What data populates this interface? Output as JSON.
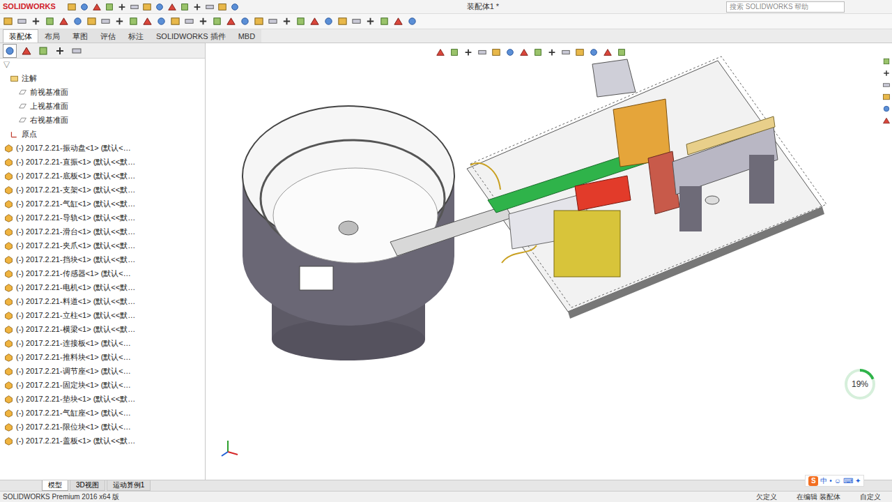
{
  "app": {
    "logo": "SOLIDWORKS",
    "title": "装配体1 *",
    "search_placeholder": "搜索 SOLIDWORKS 帮助"
  },
  "command_tabs": [
    {
      "label": "装配体",
      "selected": true
    },
    {
      "label": "布局",
      "selected": false
    },
    {
      "label": "草图",
      "selected": false
    },
    {
      "label": "评估",
      "selected": false
    },
    {
      "label": "标注",
      "selected": false
    },
    {
      "label": "SOLIDWORKS 插件",
      "selected": false
    },
    {
      "label": "MBD",
      "selected": false
    }
  ],
  "panel_tabs": [
    {
      "selected": true
    },
    {
      "selected": false
    },
    {
      "selected": false
    },
    {
      "selected": false
    },
    {
      "selected": false
    }
  ],
  "tree": {
    "filter": "▽",
    "items": [
      {
        "label": "注解",
        "kind": "folder"
      },
      {
        "label": "前视基准面",
        "kind": "plane"
      },
      {
        "label": "上视基准面",
        "kind": "plane"
      },
      {
        "label": "右视基准面",
        "kind": "plane"
      },
      {
        "label": "原点",
        "kind": "origin"
      },
      {
        "label": "(-) 2017.2.21-振动盘<1> (默认<…",
        "kind": "part"
      },
      {
        "label": "(-) 2017.2.21-直振<1> (默认<<默…",
        "kind": "part"
      },
      {
        "label": "(-) 2017.2.21-底板<1> (默认<<默…",
        "kind": "part"
      },
      {
        "label": "(-) 2017.2.21-支架<1> (默认<<默…",
        "kind": "part"
      },
      {
        "label": "(-) 2017.2.21-气缸<1> (默认<<默…",
        "kind": "part"
      },
      {
        "label": "(-) 2017.2.21-导轨<1> (默认<<默…",
        "kind": "part"
      },
      {
        "label": "(-) 2017.2.21-滑台<1> (默认<<默…",
        "kind": "part"
      },
      {
        "label": "(-) 2017.2.21-夹爪<1> (默认<<默…",
        "kind": "part"
      },
      {
        "label": "(-) 2017.2.21-挡块<1> (默认<<默…",
        "kind": "part"
      },
      {
        "label": "(-) 2017.2.21-传感器<1> (默认<…",
        "kind": "part"
      },
      {
        "label": "(-) 2017.2.21-电机<1> (默认<<默…",
        "kind": "part"
      },
      {
        "label": "(-) 2017.2.21-料道<1> (默认<<默…",
        "kind": "part"
      },
      {
        "label": "(-) 2017.2.21-立柱<1> (默认<<默…",
        "kind": "part"
      },
      {
        "label": "(-) 2017.2.21-横梁<1> (默认<<默…",
        "kind": "part"
      },
      {
        "label": "(-) 2017.2.21-连接板<1> (默认<…",
        "kind": "part"
      },
      {
        "label": "(-) 2017.2.21-推料块<1> (默认<…",
        "kind": "part"
      },
      {
        "label": "(-) 2017.2.21-调节座<1> (默认<…",
        "kind": "part"
      },
      {
        "label": "(-) 2017.2.21-固定块<1> (默认<…",
        "kind": "part"
      },
      {
        "label": "(-) 2017.2.21-垫块<1> (默认<<默…",
        "kind": "part"
      },
      {
        "label": "(-) 2017.2.21-气缸座<1> (默认<…",
        "kind": "part"
      },
      {
        "label": "(-) 2017.2.21-限位块<1> (默认<…",
        "kind": "part"
      },
      {
        "label": "(-) 2017.2.21-盖板<1> (默认<<默…",
        "kind": "part"
      }
    ]
  },
  "progress": {
    "label": "19%",
    "level": 0.19
  },
  "bottom_tabs": [
    {
      "label": "模型",
      "selected": true
    },
    {
      "label": "3D视图",
      "selected": false
    },
    {
      "label": "运动算例1",
      "selected": false
    }
  ],
  "status": {
    "left": "SOLIDWORKS Premium 2016 x64 版",
    "items": [
      "欠定义",
      "在编辑 装配体",
      "自定义"
    ]
  },
  "ime": {
    "logo": "S",
    "labels": [
      "中",
      "•",
      "☺",
      "⌨",
      "✦"
    ]
  }
}
